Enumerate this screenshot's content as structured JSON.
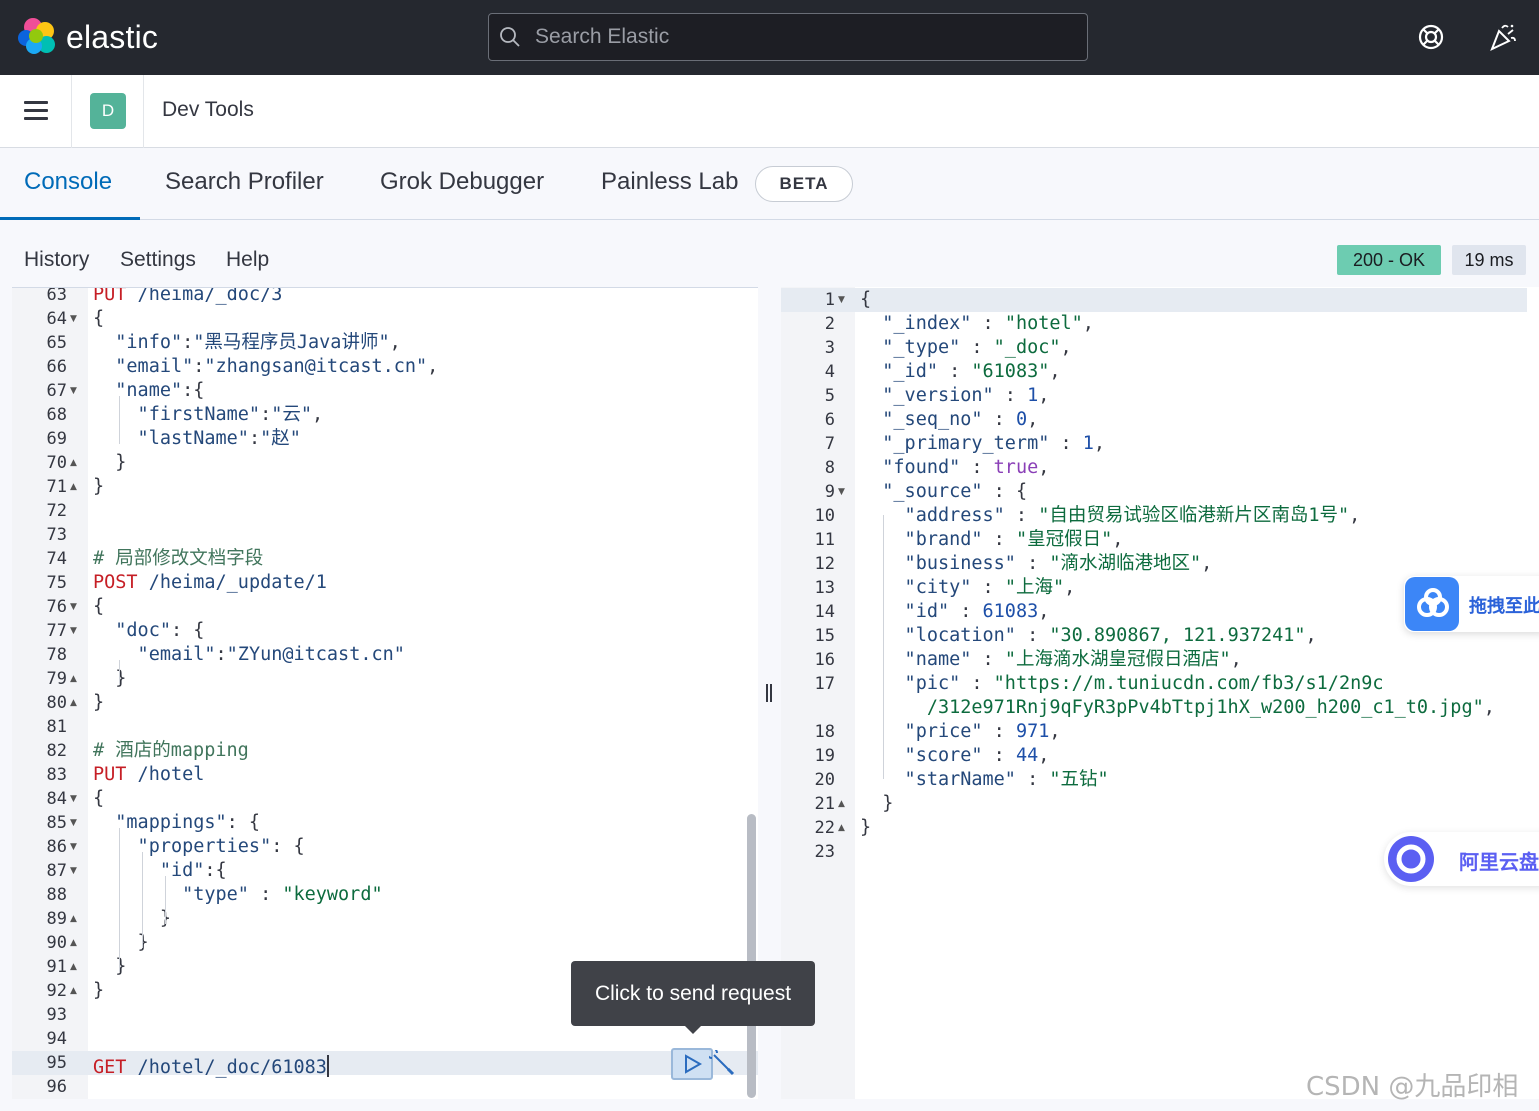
{
  "header": {
    "brand": "elastic",
    "search_placeholder": "Search Elastic",
    "help_icon": "lifebuoy-icon",
    "news_icon": "party-popper-icon"
  },
  "appbar": {
    "avatar_letter": "D",
    "title": "Dev Tools"
  },
  "tabs": [
    {
      "label": "Console",
      "active": true
    },
    {
      "label": "Search Profiler"
    },
    {
      "label": "Grok Debugger"
    },
    {
      "label": "Painless Lab"
    }
  ],
  "beta_badge": "BETA",
  "console_menu": {
    "history": "History",
    "settings": "Settings",
    "help": "Help"
  },
  "response_status": {
    "status": "200 - OK",
    "time": "19 ms"
  },
  "tooltip": "Click to send request",
  "left_editor": {
    "line_numbers": [
      "63",
      "64",
      "65",
      "66",
      "67",
      "68",
      "69",
      "70",
      "71",
      "72",
      "73",
      "74",
      "75",
      "76",
      "77",
      "78",
      "79",
      "80",
      "81",
      "82",
      "83",
      "84",
      "85",
      "86",
      "87",
      "88",
      "89",
      "90",
      "91",
      "92",
      "93",
      "94",
      "95",
      "96"
    ],
    "lines": [
      [
        {
          "t": "PUT",
          "c": "method"
        },
        {
          "t": " /heima/_doc/3",
          "c": "path"
        }
      ],
      [
        {
          "t": "{",
          "c": "plain"
        }
      ],
      [
        {
          "t": "  \"info\"",
          "c": "key"
        },
        {
          "t": ":",
          "c": "plain"
        },
        {
          "t": "\"黑马程序员Java讲师\"",
          "c": "str"
        },
        {
          "t": ",",
          "c": "plain"
        }
      ],
      [
        {
          "t": "  \"email\"",
          "c": "key"
        },
        {
          "t": ":",
          "c": "plain"
        },
        {
          "t": "\"zhangsan@itcast.cn\"",
          "c": "str"
        },
        {
          "t": ",",
          "c": "plain"
        }
      ],
      [
        {
          "t": "  \"name\"",
          "c": "key"
        },
        {
          "t": ":{",
          "c": "plain"
        }
      ],
      [
        {
          "t": "    \"firstName\"",
          "c": "key"
        },
        {
          "t": ":",
          "c": "plain"
        },
        {
          "t": "\"云\"",
          "c": "str"
        },
        {
          "t": ",",
          "c": "plain"
        }
      ],
      [
        {
          "t": "    \"lastName\"",
          "c": "key"
        },
        {
          "t": ":",
          "c": "plain"
        },
        {
          "t": "\"赵\"",
          "c": "str"
        }
      ],
      [
        {
          "t": "  }",
          "c": "plain"
        }
      ],
      [
        {
          "t": "}",
          "c": "plain"
        }
      ],
      [],
      [],
      [
        {
          "t": "# 局部修改文档字段",
          "c": "comment"
        }
      ],
      [
        {
          "t": "POST",
          "c": "method"
        },
        {
          "t": " /heima/_update/1",
          "c": "path"
        }
      ],
      [
        {
          "t": "{",
          "c": "plain"
        }
      ],
      [
        {
          "t": "  \"doc\"",
          "c": "key"
        },
        {
          "t": ": {",
          "c": "plain"
        }
      ],
      [
        {
          "t": "    \"email\"",
          "c": "key"
        },
        {
          "t": ":",
          "c": "plain"
        },
        {
          "t": "\"ZYun@itcast.cn\"",
          "c": "str"
        }
      ],
      [
        {
          "t": "  }",
          "c": "plain"
        }
      ],
      [
        {
          "t": "}",
          "c": "plain"
        }
      ],
      [],
      [
        {
          "t": "# 酒店的mapping",
          "c": "comment"
        }
      ],
      [
        {
          "t": "PUT",
          "c": "method"
        },
        {
          "t": " /hotel",
          "c": "path"
        }
      ],
      [
        {
          "t": "{",
          "c": "plain"
        }
      ],
      [
        {
          "t": "  \"mappings\"",
          "c": "key"
        },
        {
          "t": ": {",
          "c": "plain"
        }
      ],
      [
        {
          "t": "    \"properties\"",
          "c": "key"
        },
        {
          "t": ": {",
          "c": "plain"
        }
      ],
      [
        {
          "t": "      \"id\"",
          "c": "key"
        },
        {
          "t": ":{",
          "c": "plain"
        }
      ],
      [
        {
          "t": "        \"type\"",
          "c": "key"
        },
        {
          "t": " : ",
          "c": "plain"
        },
        {
          "t": "\"keyword\"",
          "c": "strg"
        }
      ],
      [
        {
          "t": "      }",
          "c": "plain"
        }
      ],
      [
        {
          "t": "    }",
          "c": "plain"
        }
      ],
      [
        {
          "t": "  }",
          "c": "plain"
        }
      ],
      [
        {
          "t": "}",
          "c": "plain"
        }
      ],
      [],
      [],
      [
        {
          "t": "GET",
          "c": "method"
        },
        {
          "t": " /hotel/_doc/61083",
          "c": "path"
        }
      ],
      []
    ],
    "fold_markers": {
      "64": "down",
      "67": "down",
      "70": "up",
      "71": "up",
      "76": "down",
      "77": "down",
      "79": "up",
      "80": "up",
      "84": "down",
      "85": "down",
      "86": "down",
      "87": "down",
      "89": "up",
      "90": "up",
      "91": "up",
      "92": "up"
    }
  },
  "right_editor": {
    "line_numbers": [
      "1",
      "2",
      "3",
      "4",
      "5",
      "6",
      "7",
      "8",
      "9",
      "10",
      "11",
      "12",
      "13",
      "14",
      "15",
      "16",
      "17",
      "",
      "18",
      "19",
      "20",
      "21",
      "22",
      "23"
    ],
    "lines": [
      [
        {
          "t": "{",
          "c": "plain"
        }
      ],
      [
        {
          "t": "  \"_index\"",
          "c": "key"
        },
        {
          "t": " : ",
          "c": "plain"
        },
        {
          "t": "\"hotel\"",
          "c": "strg"
        },
        {
          "t": ",",
          "c": "plain"
        }
      ],
      [
        {
          "t": "  \"_type\"",
          "c": "key"
        },
        {
          "t": " : ",
          "c": "plain"
        },
        {
          "t": "\"_doc\"",
          "c": "strg"
        },
        {
          "t": ",",
          "c": "plain"
        }
      ],
      [
        {
          "t": "  \"_id\"",
          "c": "key"
        },
        {
          "t": " : ",
          "c": "plain"
        },
        {
          "t": "\"61083\"",
          "c": "strg"
        },
        {
          "t": ",",
          "c": "plain"
        }
      ],
      [
        {
          "t": "  \"_version\"",
          "c": "key"
        },
        {
          "t": " : ",
          "c": "plain"
        },
        {
          "t": "1",
          "c": "num"
        },
        {
          "t": ",",
          "c": "plain"
        }
      ],
      [
        {
          "t": "  \"_seq_no\"",
          "c": "key"
        },
        {
          "t": " : ",
          "c": "plain"
        },
        {
          "t": "0",
          "c": "num"
        },
        {
          "t": ",",
          "c": "plain"
        }
      ],
      [
        {
          "t": "  \"_primary_term\"",
          "c": "key"
        },
        {
          "t": " : ",
          "c": "plain"
        },
        {
          "t": "1",
          "c": "num"
        },
        {
          "t": ",",
          "c": "plain"
        }
      ],
      [
        {
          "t": "  \"found\"",
          "c": "key"
        },
        {
          "t": " : ",
          "c": "plain"
        },
        {
          "t": "true",
          "c": "bool"
        },
        {
          "t": ",",
          "c": "plain"
        }
      ],
      [
        {
          "t": "  \"_source\"",
          "c": "key"
        },
        {
          "t": " : {",
          "c": "plain"
        }
      ],
      [
        {
          "t": "    \"address\"",
          "c": "key"
        },
        {
          "t": " : ",
          "c": "plain"
        },
        {
          "t": "\"自由贸易试验区临港新片区南岛1号\"",
          "c": "strg"
        },
        {
          "t": ",",
          "c": "plain"
        }
      ],
      [
        {
          "t": "    \"brand\"",
          "c": "key"
        },
        {
          "t": " : ",
          "c": "plain"
        },
        {
          "t": "\"皇冠假日\"",
          "c": "strg"
        },
        {
          "t": ",",
          "c": "plain"
        }
      ],
      [
        {
          "t": "    \"business\"",
          "c": "key"
        },
        {
          "t": " : ",
          "c": "plain"
        },
        {
          "t": "\"滴水湖临港地区\"",
          "c": "strg"
        },
        {
          "t": ",",
          "c": "plain"
        }
      ],
      [
        {
          "t": "    \"city\"",
          "c": "key"
        },
        {
          "t": " : ",
          "c": "plain"
        },
        {
          "t": "\"上海\"",
          "c": "strg"
        },
        {
          "t": ",",
          "c": "plain"
        }
      ],
      [
        {
          "t": "    \"id\"",
          "c": "key"
        },
        {
          "t": " : ",
          "c": "plain"
        },
        {
          "t": "61083",
          "c": "num"
        },
        {
          "t": ",",
          "c": "plain"
        }
      ],
      [
        {
          "t": "    \"location\"",
          "c": "key"
        },
        {
          "t": " : ",
          "c": "plain"
        },
        {
          "t": "\"30.890867, 121.937241\"",
          "c": "strg"
        },
        {
          "t": ",",
          "c": "plain"
        }
      ],
      [
        {
          "t": "    \"name\"",
          "c": "key"
        },
        {
          "t": " : ",
          "c": "plain"
        },
        {
          "t": "\"上海滴水湖皇冠假日酒店\"",
          "c": "strg"
        },
        {
          "t": ",",
          "c": "plain"
        }
      ],
      [
        {
          "t": "    \"pic\"",
          "c": "key"
        },
        {
          "t": " : ",
          "c": "plain"
        },
        {
          "t": "\"https://m.tuniucdn.com/fb3/s1/2n9c",
          "c": "strg"
        }
      ],
      [
        {
          "t": "      /312e971Rnj9qFyR3pPv4bTtpj1hX_w200_h200_c1_t0.jpg\"",
          "c": "strg"
        },
        {
          "t": ",",
          "c": "plain"
        }
      ],
      [
        {
          "t": "    \"price\"",
          "c": "key"
        },
        {
          "t": " : ",
          "c": "plain"
        },
        {
          "t": "971",
          "c": "num"
        },
        {
          "t": ",",
          "c": "plain"
        }
      ],
      [
        {
          "t": "    \"score\"",
          "c": "key"
        },
        {
          "t": " : ",
          "c": "plain"
        },
        {
          "t": "44",
          "c": "num"
        },
        {
          "t": ",",
          "c": "plain"
        }
      ],
      [
        {
          "t": "    \"starName\"",
          "c": "key"
        },
        {
          "t": " : ",
          "c": "plain"
        },
        {
          "t": "\"五钻\"",
          "c": "strg"
        }
      ],
      [
        {
          "t": "  }",
          "c": "plain"
        }
      ],
      [
        {
          "t": "}",
          "c": "plain"
        }
      ],
      []
    ],
    "fold_markers": {
      "1": "down",
      "9": "down",
      "21": "up",
      "22": "up"
    }
  },
  "overlays": {
    "baidu_label": "拖拽至此",
    "aliyun_label": "阿里云盘",
    "watermark": "CSDN @九品印相"
  }
}
